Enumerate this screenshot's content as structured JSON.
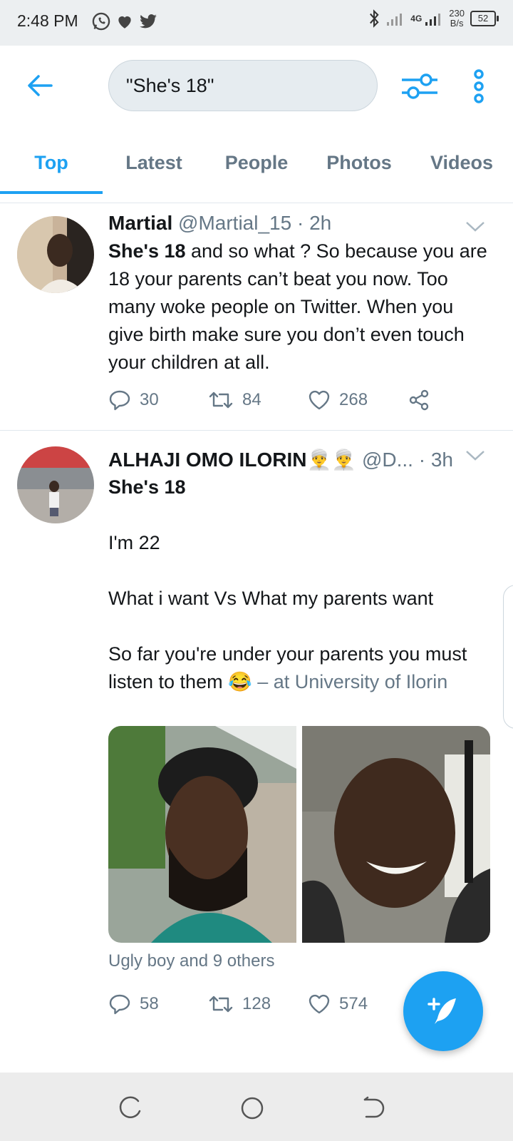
{
  "status_bar": {
    "time": "2:48 PM",
    "app_icons": [
      "whatsapp-icon",
      "heart-icon",
      "twitter-icon"
    ],
    "network_label": "4G",
    "speed_value": "230",
    "speed_unit": "B/s",
    "battery": "52"
  },
  "search": {
    "query": "\"She's 18\""
  },
  "tabs": [
    {
      "label": "Top",
      "active": true
    },
    {
      "label": "Latest",
      "active": false
    },
    {
      "label": "People",
      "active": false
    },
    {
      "label": "Photos",
      "active": false
    },
    {
      "label": "Videos",
      "active": false
    }
  ],
  "tweets": [
    {
      "name": "Martial",
      "handle": "@Martial_15",
      "separator": "·",
      "time": "2h",
      "body_bold": "She's 18",
      "body_rest": " and so what ? So  because you are 18 your parents can’t beat you now. Too many woke people on Twitter. When you give birth make sure you don’t even touch your children at all.",
      "replies": "30",
      "retweets": "84",
      "likes": "268"
    },
    {
      "name": "ALHAJI OMO ILORIN👳‍♂️👳‍♂️",
      "handle": "@D...",
      "separator": "·",
      "time": "3h",
      "line1": "She's 18",
      "line2": "I'm 22",
      "line3": "What i want Vs What my parents want",
      "line4": "So far you're under your parents you must listen to them 😂",
      "location": " – at University of Ilorin",
      "liked_by": "Ugly boy and 9 others",
      "replies": "58",
      "retweets": "128",
      "likes": "574"
    }
  ],
  "colors": {
    "accent": "#1da1f2",
    "secondary_text": "#657786",
    "divider": "#e1e8ed"
  }
}
